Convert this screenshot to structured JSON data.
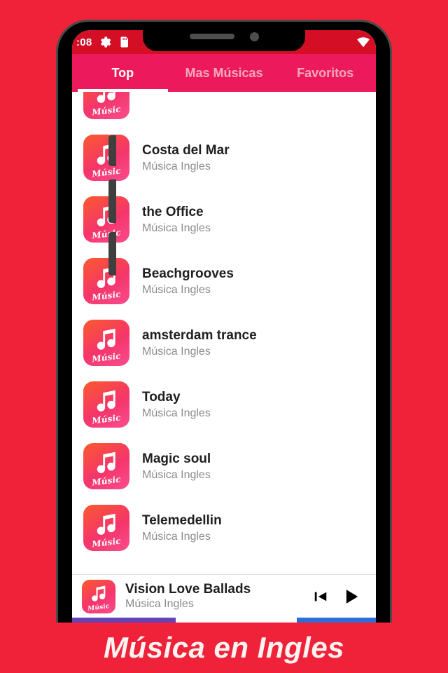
{
  "app": {
    "promo_caption": "Música en Ingles",
    "background_color": "#ef2239",
    "accent_color": "#ec1a5c",
    "status_bar_color": "#d40f25"
  },
  "status_bar": {
    "time": ":08",
    "icons": [
      "gear-icon",
      "sd-card-icon"
    ],
    "right_icons": [
      "wifi-icon"
    ]
  },
  "tabs": [
    {
      "label": "Top",
      "active": true
    },
    {
      "label": "Mas Músicas",
      "active": false
    },
    {
      "label": "Favoritos",
      "active": false
    }
  ],
  "list": {
    "album_art_label": "Músic",
    "items": [
      {
        "title": "Costa del Mar",
        "subtitle": "Música Ingles"
      },
      {
        "title": "the Office",
        "subtitle": "Música Ingles"
      },
      {
        "title": "Beachgrooves",
        "subtitle": "Música Ingles"
      },
      {
        "title": "amsterdam trance",
        "subtitle": "Música Ingles"
      },
      {
        "title": "Today",
        "subtitle": "Música Ingles"
      },
      {
        "title": "Magic soul",
        "subtitle": "Música Ingles"
      },
      {
        "title": "Telemedellin",
        "subtitle": "Música Ingles"
      }
    ]
  },
  "now_playing": {
    "title": "Vision Love Ballads",
    "subtitle": "Música Ingles",
    "album_art_label": "Músic",
    "controls": [
      "previous-track-icon",
      "play-icon"
    ]
  }
}
